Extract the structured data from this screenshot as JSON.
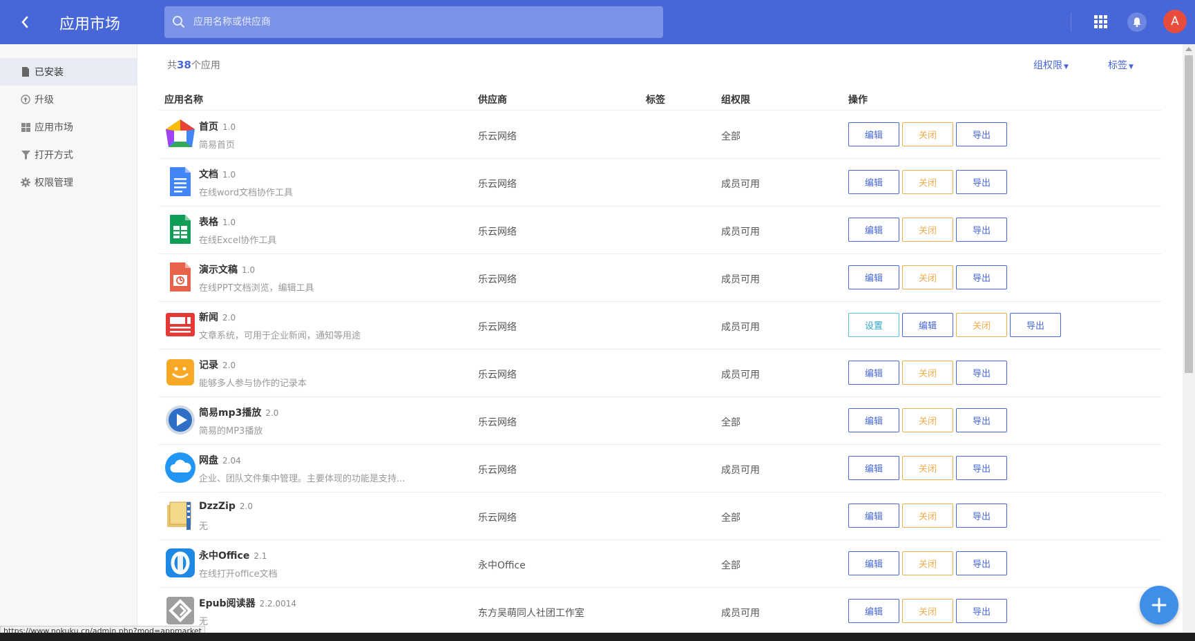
{
  "header": {
    "title": "应用市场",
    "search_placeholder": "应用名称或供应商",
    "avatar_letter": "A"
  },
  "sidebar": {
    "items": [
      {
        "label": "已安装",
        "icon": "file-icon",
        "active": true
      },
      {
        "label": "升级",
        "icon": "upgrade-icon",
        "active": false
      },
      {
        "label": "应用市场",
        "icon": "grid-icon",
        "active": false
      },
      {
        "label": "打开方式",
        "icon": "filter-icon",
        "active": false
      },
      {
        "label": "权限管理",
        "icon": "gear-icon",
        "active": false
      }
    ]
  },
  "summary": {
    "prefix": "共",
    "count": "38",
    "suffix": "个应用"
  },
  "filters": {
    "group_perm": "组权限",
    "tags": "标签"
  },
  "table": {
    "headers": {
      "name": "应用名称",
      "vendor": "供应商",
      "tag": "标签",
      "perm": "组权限",
      "ops": "操作"
    },
    "rows": [
      {
        "name": "首页",
        "version": "1.0",
        "desc": "简易首页",
        "vendor": "乐云网络",
        "perm": "全部",
        "icon": "home-app-icon",
        "ops": [
          "编辑",
          "关闭",
          "导出"
        ]
      },
      {
        "name": "文档",
        "version": "1.0",
        "desc": "在线word文档协作工具",
        "vendor": "乐云网络",
        "perm": "成员可用",
        "icon": "doc-app-icon",
        "ops": [
          "编辑",
          "关闭",
          "导出"
        ]
      },
      {
        "name": "表格",
        "version": "1.0",
        "desc": "在线Excel协作工具",
        "vendor": "乐云网络",
        "perm": "成员可用",
        "icon": "sheet-app-icon",
        "ops": [
          "编辑",
          "关闭",
          "导出"
        ]
      },
      {
        "name": "演示文稿",
        "version": "1.0",
        "desc": "在线PPT文档浏览，编辑工具",
        "vendor": "乐云网络",
        "perm": "成员可用",
        "icon": "slides-app-icon",
        "ops": [
          "编辑",
          "关闭",
          "导出"
        ]
      },
      {
        "name": "新闻",
        "version": "2.0",
        "desc": "文章系统，可用于企业新闻，通知等用途",
        "vendor": "乐云网络",
        "perm": "成员可用",
        "icon": "news-app-icon",
        "ops": [
          "设置",
          "编辑",
          "关闭",
          "导出"
        ]
      },
      {
        "name": "记录",
        "version": "2.0",
        "desc": "能够多人参与协作的记录本",
        "vendor": "乐云网络",
        "perm": "成员可用",
        "icon": "notes-app-icon",
        "ops": [
          "编辑",
          "关闭",
          "导出"
        ]
      },
      {
        "name": "简易mp3播放",
        "version": "2.0",
        "desc": "简易的MP3播放",
        "vendor": "乐云网络",
        "perm": "全部",
        "icon": "mp3-app-icon",
        "ops": [
          "编辑",
          "关闭",
          "导出"
        ]
      },
      {
        "name": "网盘",
        "version": "2.04",
        "desc": "企业、团队文件集中管理。主要体现的功能是支持...",
        "vendor": "乐云网络",
        "perm": "成员可用",
        "icon": "cloud-app-icon",
        "ops": [
          "编辑",
          "关闭",
          "导出"
        ]
      },
      {
        "name": "DzzZip",
        "version": "2.0",
        "desc": "无",
        "vendor": "乐云网络",
        "perm": "全部",
        "icon": "zip-app-icon",
        "ops": [
          "编辑",
          "关闭",
          "导出"
        ]
      },
      {
        "name": "永中Office",
        "version": "2.1",
        "desc": "在线打开office文档",
        "vendor": "永中Office",
        "perm": "全部",
        "icon": "yozo-app-icon",
        "ops": [
          "编辑",
          "关闭",
          "导出"
        ]
      },
      {
        "name": "Epub阅读器",
        "version": "2.2.0014",
        "desc": "无",
        "vendor": "东方吴萌同人社团工作室",
        "perm": "成员可用",
        "icon": "epub-app-icon",
        "ops": [
          "编辑",
          "关闭",
          "导出"
        ]
      }
    ]
  },
  "status_url": "https://www.nokuku.cn/admin.php?mod=appmarket",
  "colors": {
    "primary": "#4767d8",
    "close": "#f0ad4e",
    "setting": "#5bc0de",
    "fab": "#3f8ee8",
    "avatar": "#e74c3c"
  }
}
